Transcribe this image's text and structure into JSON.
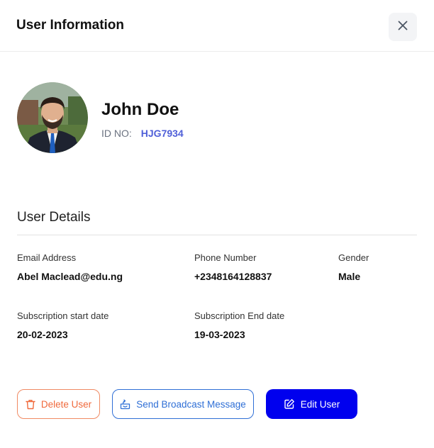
{
  "header": {
    "title": "User Information",
    "close_icon": "close-icon"
  },
  "profile": {
    "name": "John Doe",
    "id_label": "ID NO:",
    "id_value": "HJG7934",
    "avatar_icon": "avatar-photo"
  },
  "details": {
    "section_title": "User Details",
    "fields": [
      {
        "label": "Email Address",
        "value": "Abel Maclead@edu.ng"
      },
      {
        "label": "Phone Number",
        "value": "+2348164128837"
      },
      {
        "label": "Gender",
        "value": "Male"
      },
      {
        "label": "Subscription start date",
        "value": "20-02-2023"
      },
      {
        "label": "Subscription End date",
        "value": "19-03-2023"
      }
    ]
  },
  "actions": {
    "delete_label": "Delete User",
    "broadcast_label": "Send Broadcast Message",
    "edit_label": "Edit User"
  },
  "colors": {
    "delete": "#f06a3c",
    "broadcast": "#2f6fd6",
    "edit_bg": "#0000ee",
    "id_value": "#4f5fd8"
  }
}
